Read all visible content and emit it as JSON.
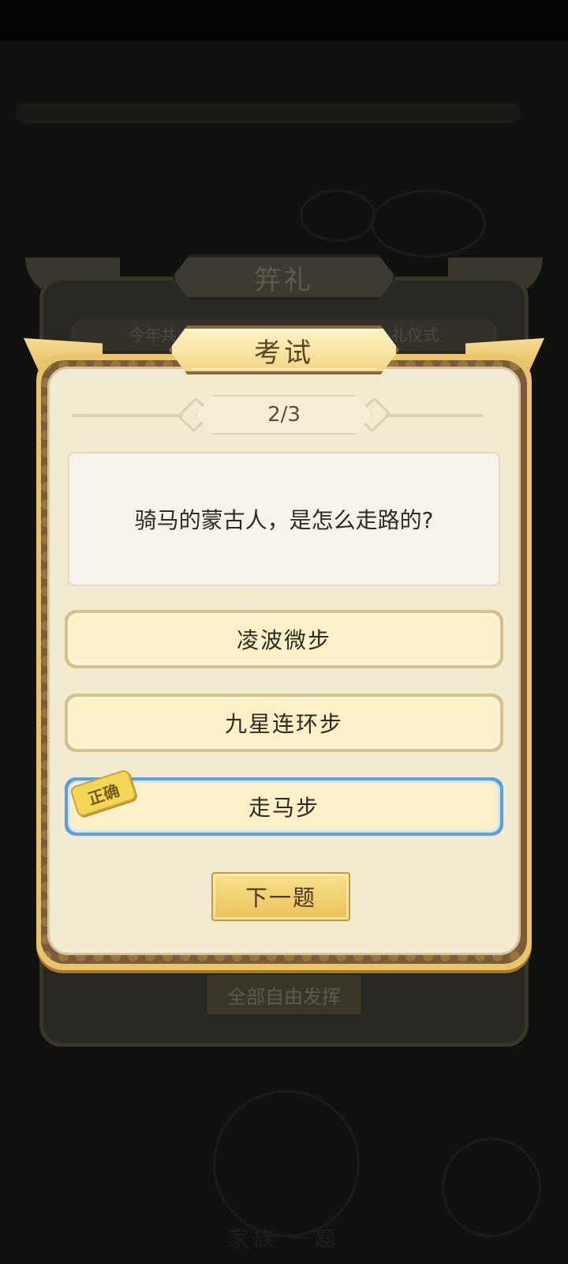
{
  "background": {
    "back_panel_title": "笄礼",
    "back_panel_banner": "今年共",
    "back_panel_banner_right": "礼仪式",
    "back_panel_button": "全部自由发挥",
    "bottom_text": "家族 一题"
  },
  "exam": {
    "title": "考试",
    "progress": "2/3",
    "question": "骑马的蒙古人，是怎么走路的?",
    "options": [
      {
        "label": "凌波微步",
        "state": "normal"
      },
      {
        "label": "九星连环步",
        "state": "normal"
      },
      {
        "label": "走马步",
        "state": "correct"
      }
    ],
    "correct_badge": "正确",
    "next_button": "下一题"
  },
  "colors": {
    "panel_gold": "#e9c46a",
    "panel_cream": "#f3ead2",
    "correct_blue": "#5f9fd6",
    "badge_yellow": "#f4d656"
  }
}
